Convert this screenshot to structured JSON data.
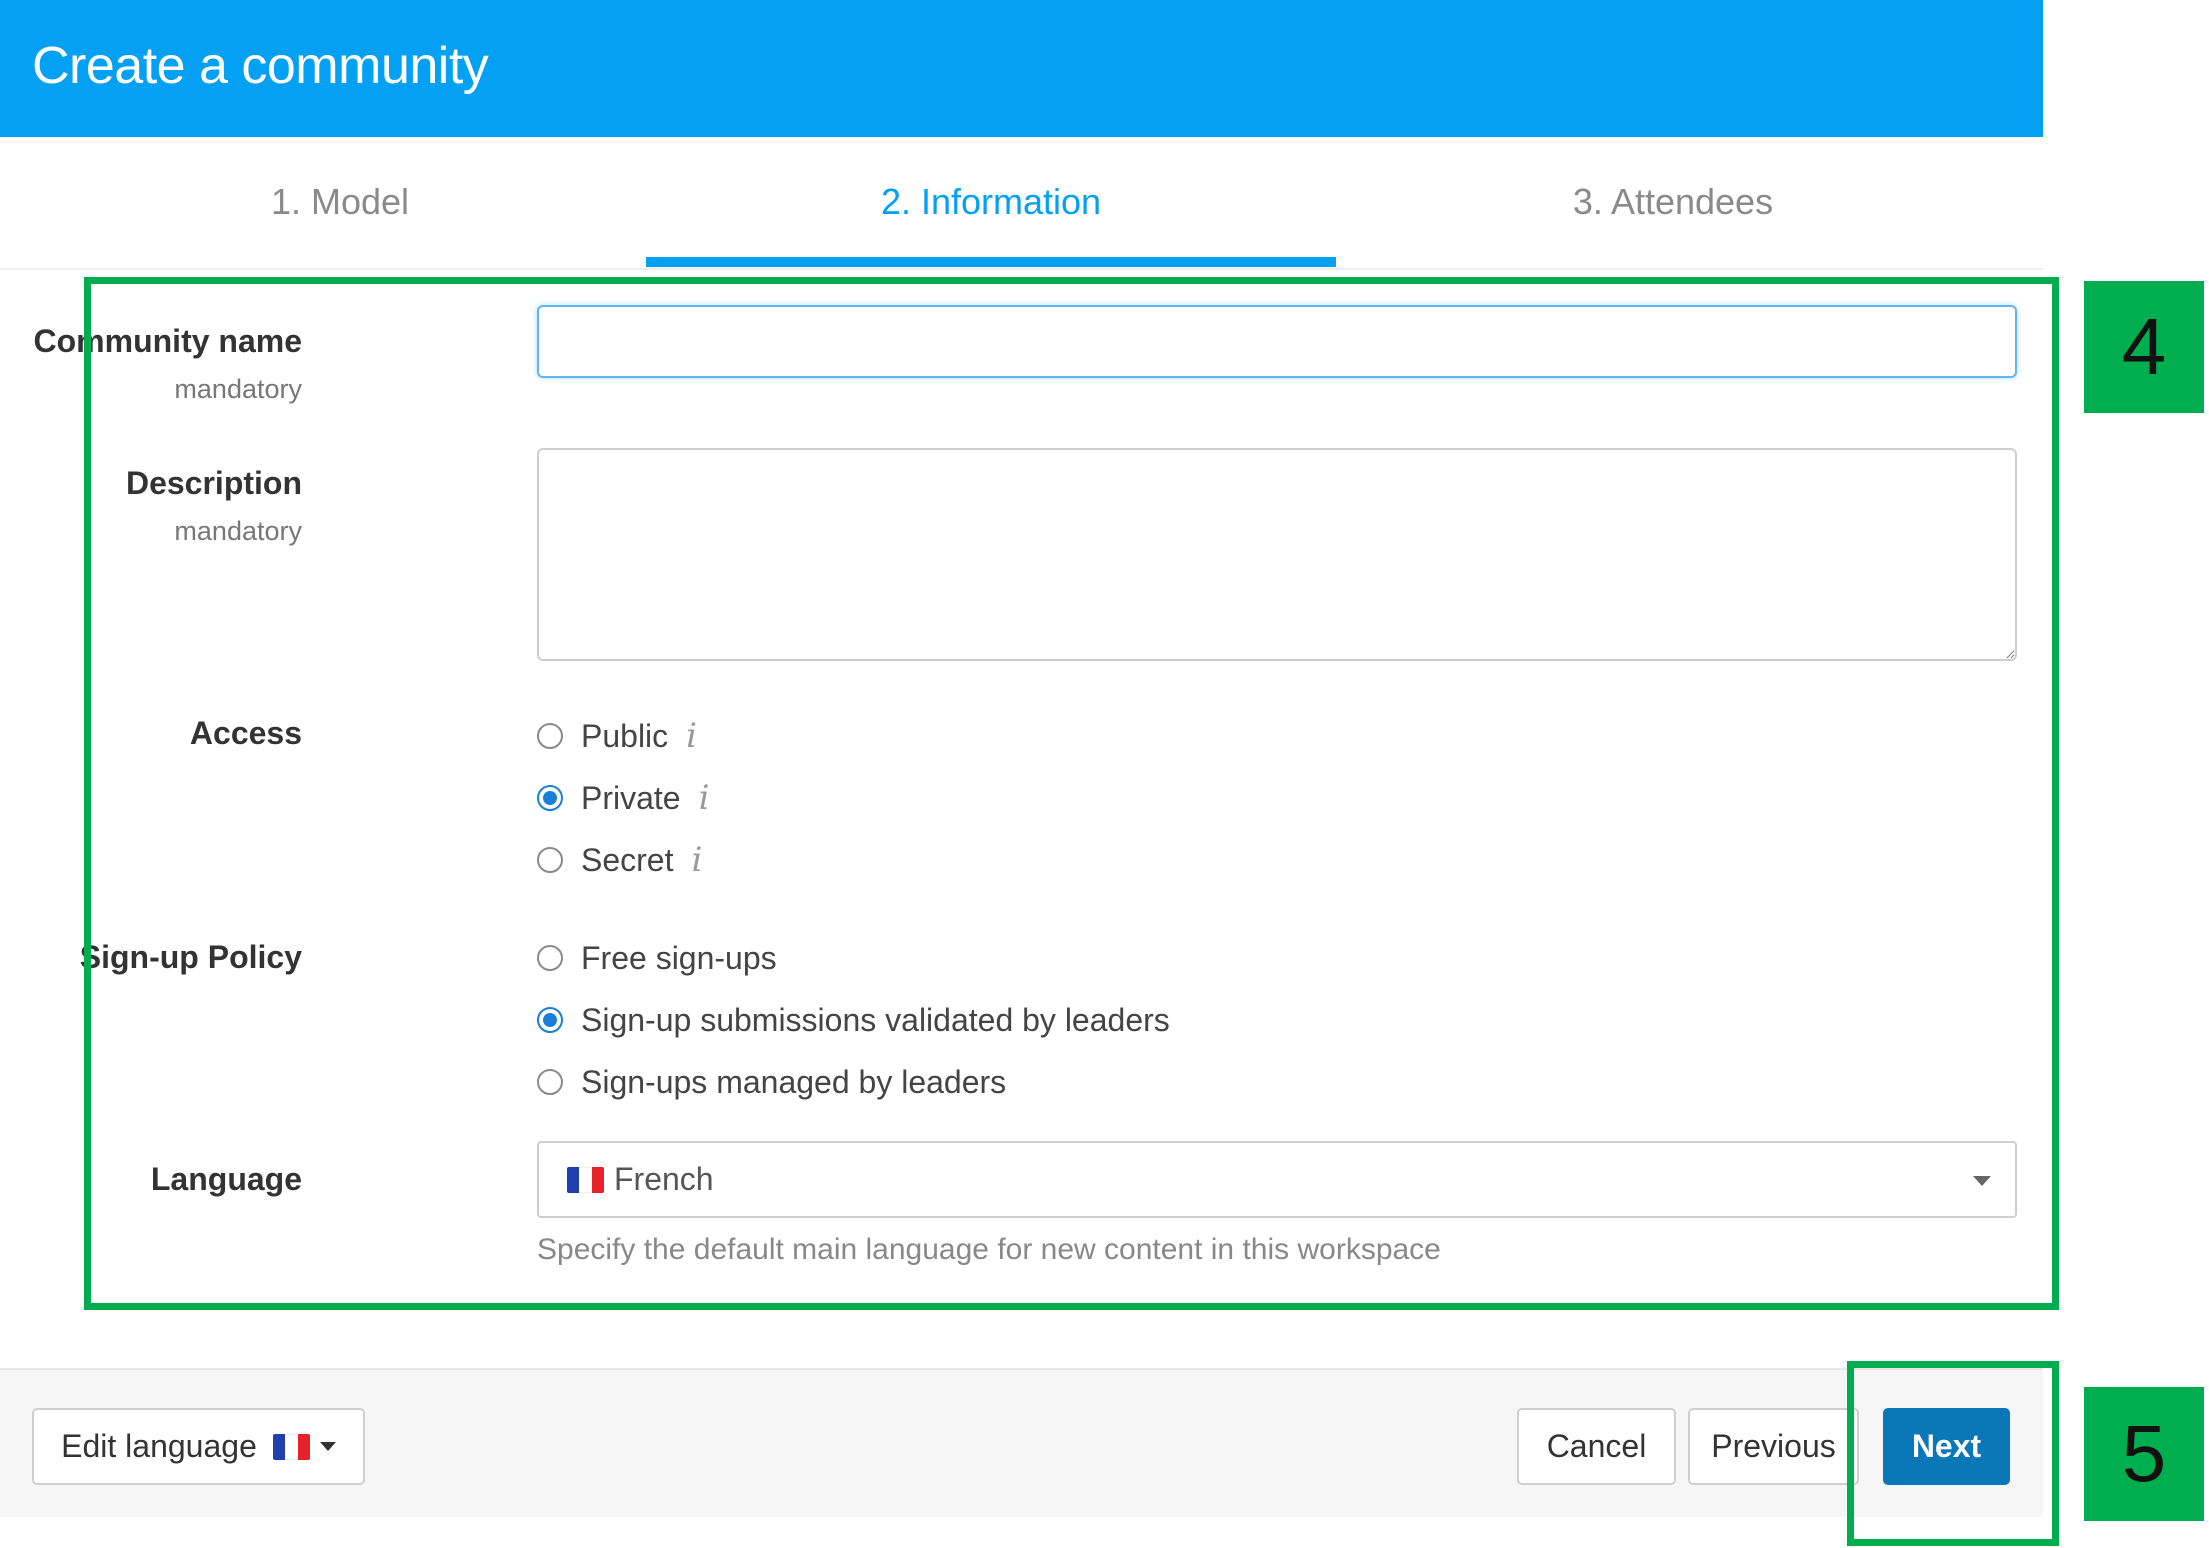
{
  "header": {
    "title": "Create a community"
  },
  "tabs": [
    {
      "label": "1. Model"
    },
    {
      "label": "2. Information"
    },
    {
      "label": "3. Attendees"
    }
  ],
  "form": {
    "community_name": {
      "label": "Community name",
      "sublabel": "mandatory",
      "value": ""
    },
    "description": {
      "label": "Description",
      "sublabel": "mandatory",
      "value": ""
    },
    "access": {
      "label": "Access",
      "options": [
        {
          "label": "Public",
          "info_icon": "i"
        },
        {
          "label": "Private",
          "info_icon": "i"
        },
        {
          "label": "Secret",
          "info_icon": "i"
        }
      ],
      "selected": "Private"
    },
    "signup_policy": {
      "label": "Sign-up Policy",
      "options": [
        {
          "label": "Free sign-ups"
        },
        {
          "label": "Sign-up submissions validated by leaders"
        },
        {
          "label": "Sign-ups managed by leaders"
        }
      ],
      "selected": "Sign-up submissions validated by leaders"
    },
    "language": {
      "label": "Language",
      "selected": "French",
      "help": "Specify the default main language for new content in this workspace"
    }
  },
  "footer": {
    "edit_language_label": "Edit language",
    "cancel_label": "Cancel",
    "previous_label": "Previous",
    "next_label": "Next"
  },
  "annotations": [
    {
      "label": "4"
    },
    {
      "label": "5"
    }
  ],
  "colors": {
    "header": "#03a0f3",
    "active_tab": "#03a0f3",
    "next_button": "#0a78b8",
    "annotation": "#00ae4f"
  },
  "icons": {
    "info": "info-icon",
    "flag": "french-flag-icon",
    "dropdown": "chevron-down-icon"
  }
}
